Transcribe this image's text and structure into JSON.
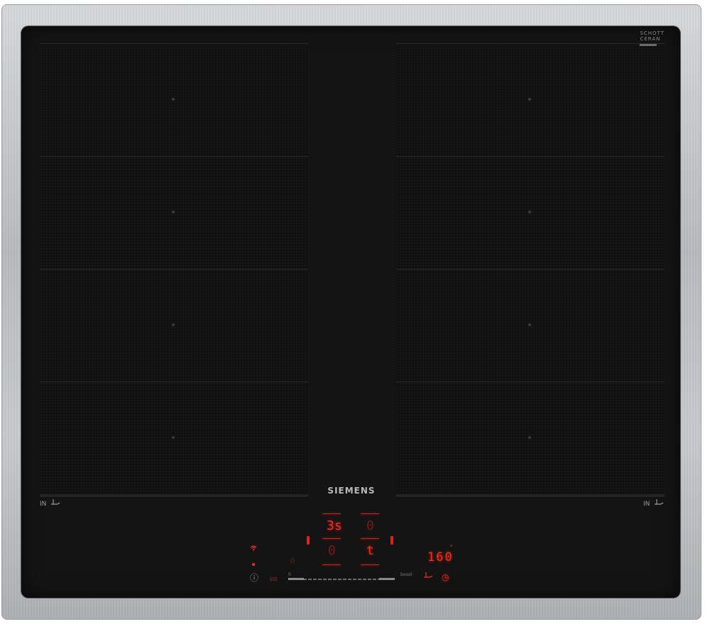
{
  "brand": "SIEMENS",
  "glass_maker": {
    "line1": "SCHOTT",
    "line2": "CERAN"
  },
  "zones": {
    "left_label": "IN",
    "right_label": "IN",
    "left_icon": "pan-move-icon",
    "right_icon": "pan-move-icon"
  },
  "controls": {
    "left_display_top": "3s",
    "left_display_bottom": "0",
    "right_display_top": "0",
    "right_display_bottom": "t",
    "timer_readout": "160",
    "slider_start": "0",
    "slider_end": "boost"
  },
  "colors": {
    "glass": "#141414",
    "display_red": "#ff2a1a",
    "frame_steel": "#c3c5c8"
  }
}
